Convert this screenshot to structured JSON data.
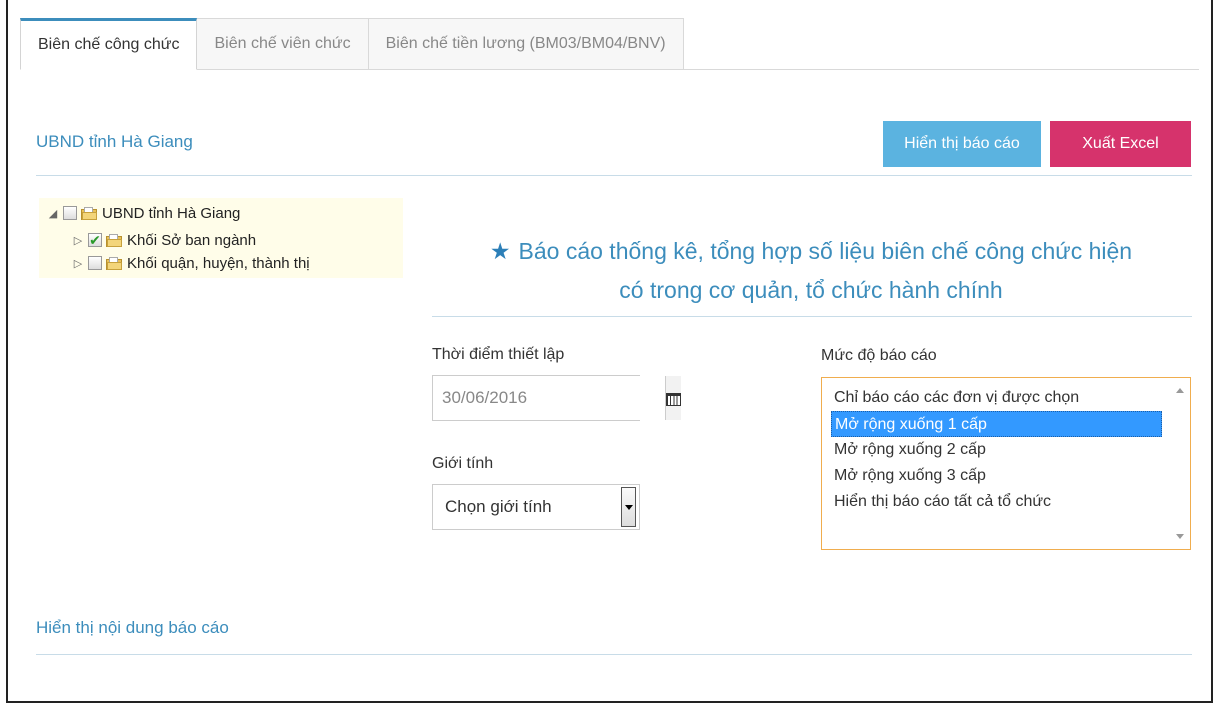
{
  "tabs": [
    {
      "label": "Biên chế công chức",
      "active": true
    },
    {
      "label": "Biên chế viên chức",
      "active": false
    },
    {
      "label": "Biên chế tiền lương (BM03/BM04/BNV)",
      "active": false
    }
  ],
  "panel": {
    "title": "UBND tỉnh Hà Giang",
    "report_button": "Hiển thị báo cáo",
    "excel_button": "Xuất Excel"
  },
  "tree": {
    "root": {
      "label": "UBND tỉnh Hà Giang",
      "checked": false
    },
    "children": [
      {
        "label": "Khối Sở ban ngành",
        "checked": true
      },
      {
        "label": "Khối quận, huyện, thành thị",
        "checked": false
      }
    ]
  },
  "report": {
    "heading_line1": "Báo cáo thống kê, tổng hợp số liệu biên chế công chức hiện",
    "heading_line2": "có trong cơ quản, tổ chức hành chính"
  },
  "form": {
    "date_label": "Thời điểm thiết lập",
    "date_value": "30/06/2016",
    "gender_label": "Giới tính",
    "gender_value": "Chọn giới tính",
    "level_label": "Mức độ báo cáo",
    "level_options": [
      "Chỉ báo cáo các đơn vị được chọn",
      "Mở rộng xuống 1 cấp",
      "Mở rộng xuống 2 cấp",
      "Mở rộng xuống 3 cấp",
      "Hiển thị báo cáo tất cả tổ chức"
    ],
    "level_selected_index": 1
  },
  "content": {
    "title": "Hiển thị nội dung báo cáo"
  },
  "colors": {
    "accent": "#3c8dbc",
    "report_button": "#5bb3e0",
    "excel_button": "#d6336c",
    "tree_bg": "#fffde9",
    "list_border": "#f0ad4e",
    "selected": "#3399ff"
  }
}
